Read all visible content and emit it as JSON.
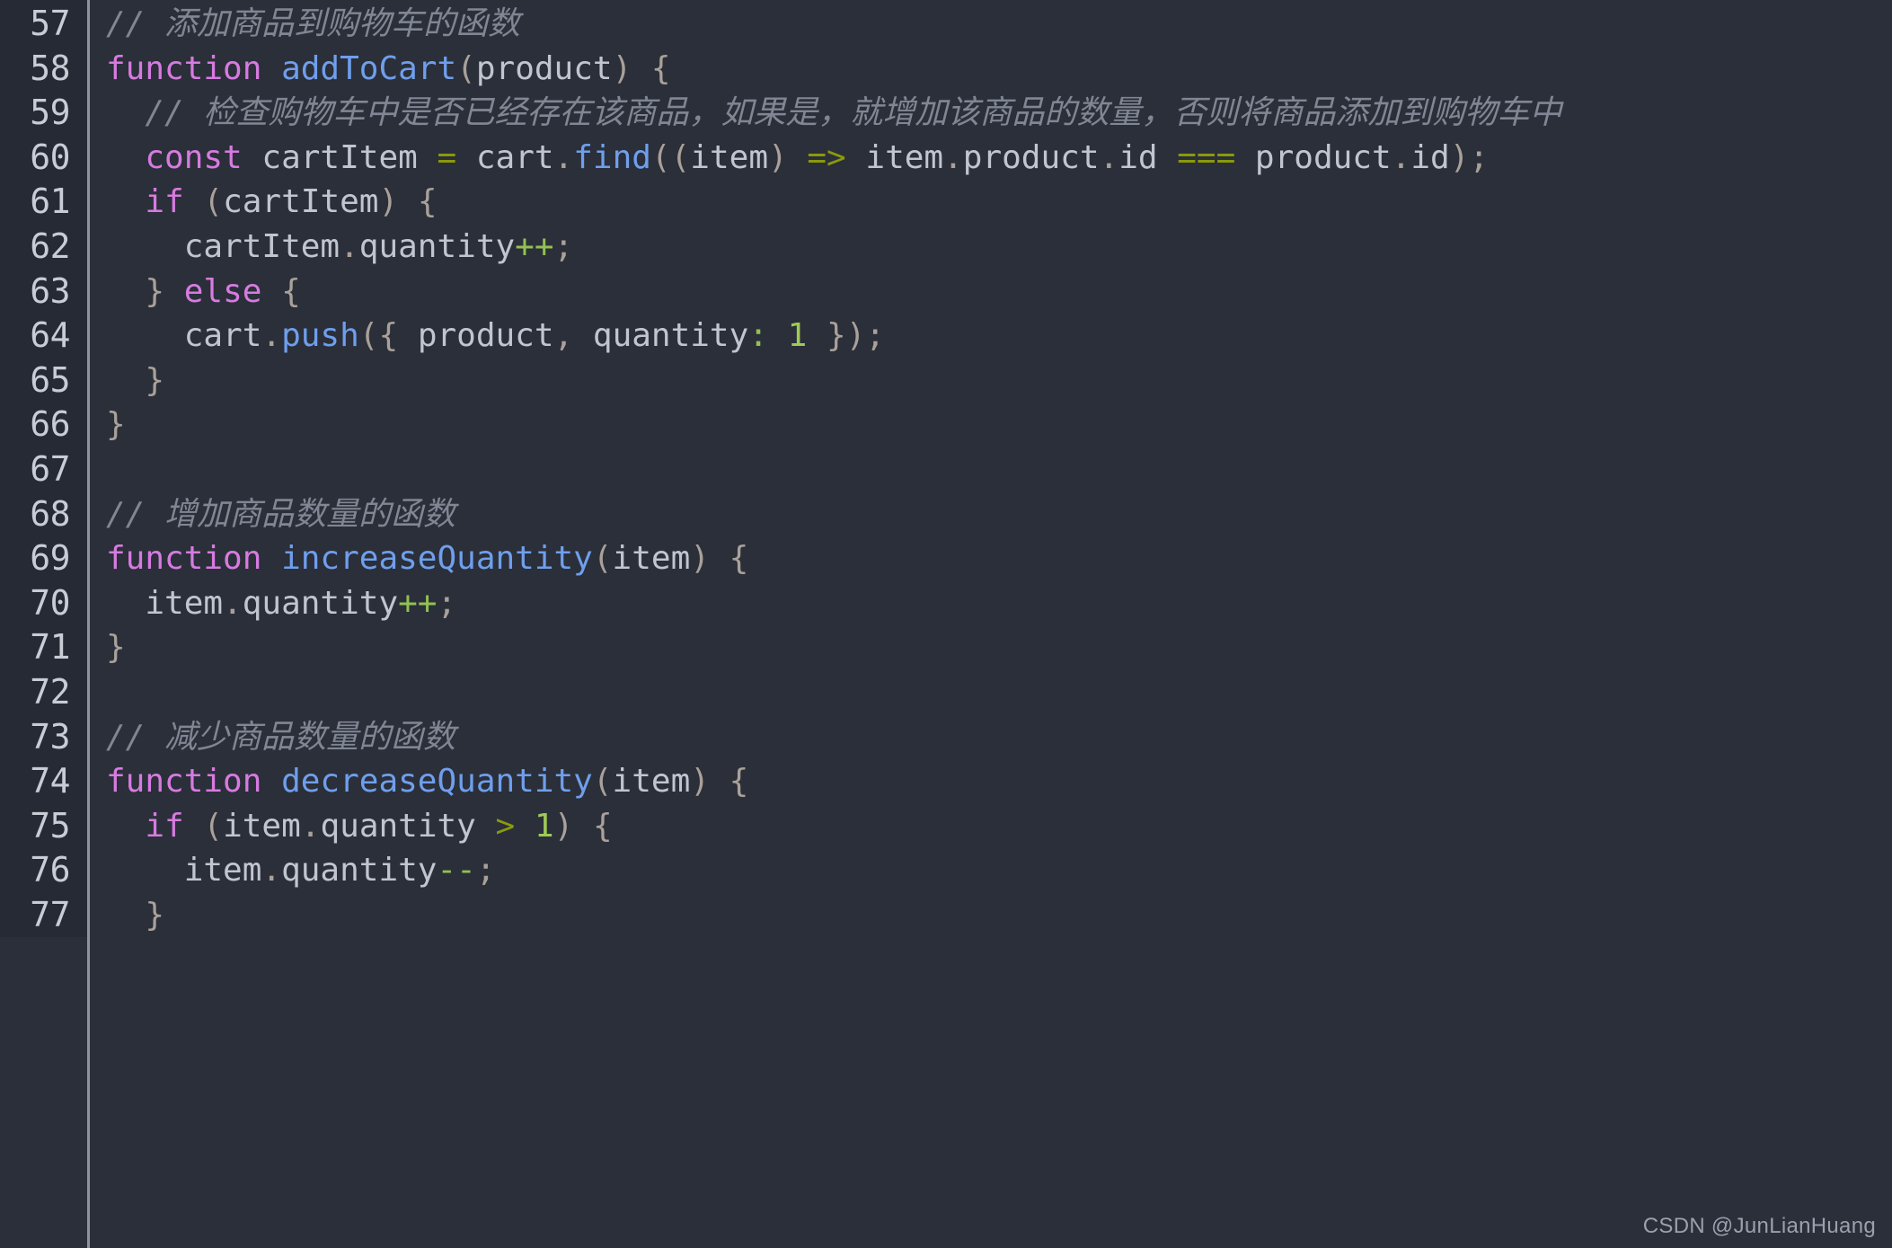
{
  "editor": {
    "language": "javascript",
    "theme": "dark",
    "background_color": "#2b2f3a",
    "gutter_color": "#262a34",
    "first_line": 57,
    "last_line": 77
  },
  "watermark": {
    "text": "CSDN @JunLianHuang"
  },
  "colors": {
    "comment": "#808693",
    "keyword": "#d77be0",
    "function": "#6f9fec",
    "plain": "#c0c5ce",
    "punctuation": "#a9a199",
    "operator": "#8a9a0b",
    "operator_bright": "#93c052",
    "number": "#9fca56",
    "line_number": "#c8ccd4"
  },
  "lines": [
    {
      "number": "57",
      "text": "// 添加商品到购物车的函数"
    },
    {
      "number": "58",
      "text": "function addToCart(product) {"
    },
    {
      "number": "59",
      "text": "  // 检查购物车中是否已经存在该商品，如果是，就增加该商品的数量，否则将商品添加到购物车中"
    },
    {
      "number": "60",
      "text": "  const cartItem = cart.find((item) => item.product.id === product.id);"
    },
    {
      "number": "61",
      "text": "  if (cartItem) {"
    },
    {
      "number": "62",
      "text": "    cartItem.quantity++;"
    },
    {
      "number": "63",
      "text": "  } else {"
    },
    {
      "number": "64",
      "text": "    cart.push({ product, quantity: 1 });"
    },
    {
      "number": "65",
      "text": "  }"
    },
    {
      "number": "66",
      "text": "}"
    },
    {
      "number": "67",
      "text": ""
    },
    {
      "number": "68",
      "text": "// 增加商品数量的函数"
    },
    {
      "number": "69",
      "text": "function increaseQuantity(item) {"
    },
    {
      "number": "70",
      "text": "  item.quantity++;"
    },
    {
      "number": "71",
      "text": "}"
    },
    {
      "number": "72",
      "text": ""
    },
    {
      "number": "73",
      "text": "// 减少商品数量的函数"
    },
    {
      "number": "74",
      "text": "function decreaseQuantity(item) {"
    },
    {
      "number": "75",
      "text": "  if (item.quantity > 1) {"
    },
    {
      "number": "76",
      "text": "    item.quantity--;"
    },
    {
      "number": "77",
      "text": "  }"
    }
  ],
  "tokenized_lines": [
    [
      {
        "t": "// 添加商品到购物车的函数",
        "c": "comment"
      }
    ],
    [
      {
        "t": "function",
        "c": "keyword"
      },
      {
        "t": " ",
        "c": "plain"
      },
      {
        "t": "addToCart",
        "c": "func"
      },
      {
        "t": "(",
        "c": "punct"
      },
      {
        "t": "product",
        "c": "plain"
      },
      {
        "t": ") {",
        "c": "punct"
      }
    ],
    [
      {
        "t": "  ",
        "c": "plain"
      },
      {
        "t": "// 检查购物车中是否已经存在该商品，如果是，就增加该商品的数量，否则将商品添加到购物车中",
        "c": "comment"
      }
    ],
    [
      {
        "t": "  ",
        "c": "plain"
      },
      {
        "t": "const",
        "c": "keyword"
      },
      {
        "t": " cartItem ",
        "c": "plain"
      },
      {
        "t": "=",
        "c": "op"
      },
      {
        "t": " cart",
        "c": "plain"
      },
      {
        "t": ".",
        "c": "punct"
      },
      {
        "t": "find",
        "c": "func"
      },
      {
        "t": "((",
        "c": "punct"
      },
      {
        "t": "item",
        "c": "plain"
      },
      {
        "t": ") ",
        "c": "punct"
      },
      {
        "t": "=>",
        "c": "op"
      },
      {
        "t": " item",
        "c": "plain"
      },
      {
        "t": ".",
        "c": "punct"
      },
      {
        "t": "product",
        "c": "plain"
      },
      {
        "t": ".",
        "c": "punct"
      },
      {
        "t": "id ",
        "c": "plain"
      },
      {
        "t": "===",
        "c": "op"
      },
      {
        "t": " product",
        "c": "plain"
      },
      {
        "t": ".",
        "c": "punct"
      },
      {
        "t": "id",
        "c": "plain"
      },
      {
        "t": ");",
        "c": "punct"
      }
    ],
    [
      {
        "t": "  ",
        "c": "plain"
      },
      {
        "t": "if",
        "c": "keyword"
      },
      {
        "t": " (",
        "c": "punct"
      },
      {
        "t": "cartItem",
        "c": "plain"
      },
      {
        "t": ") {",
        "c": "punct"
      }
    ],
    [
      {
        "t": "    cartItem",
        "c": "plain"
      },
      {
        "t": ".",
        "c": "punct"
      },
      {
        "t": "quantity",
        "c": "plain"
      },
      {
        "t": "++",
        "c": "op2"
      },
      {
        "t": ";",
        "c": "punct"
      }
    ],
    [
      {
        "t": "  ",
        "c": "plain"
      },
      {
        "t": "}",
        "c": "punct"
      },
      {
        "t": " ",
        "c": "plain"
      },
      {
        "t": "else",
        "c": "keyword"
      },
      {
        "t": " {",
        "c": "punct"
      }
    ],
    [
      {
        "t": "    cart",
        "c": "plain"
      },
      {
        "t": ".",
        "c": "punct"
      },
      {
        "t": "push",
        "c": "func"
      },
      {
        "t": "({",
        "c": "punct"
      },
      {
        "t": " product",
        "c": "plain"
      },
      {
        "t": ",",
        "c": "punct"
      },
      {
        "t": " quantity",
        "c": "plain"
      },
      {
        "t": ":",
        "c": "op2"
      },
      {
        "t": " ",
        "c": "plain"
      },
      {
        "t": "1",
        "c": "number"
      },
      {
        "t": " });",
        "c": "punct"
      }
    ],
    [
      {
        "t": "  ",
        "c": "plain"
      },
      {
        "t": "}",
        "c": "punct"
      }
    ],
    [
      {
        "t": "}",
        "c": "punct"
      }
    ],
    [],
    [
      {
        "t": "// 增加商品数量的函数",
        "c": "comment"
      }
    ],
    [
      {
        "t": "function",
        "c": "keyword"
      },
      {
        "t": " ",
        "c": "plain"
      },
      {
        "t": "increaseQuantity",
        "c": "func"
      },
      {
        "t": "(",
        "c": "punct"
      },
      {
        "t": "item",
        "c": "plain"
      },
      {
        "t": ") {",
        "c": "punct"
      }
    ],
    [
      {
        "t": "  item",
        "c": "plain"
      },
      {
        "t": ".",
        "c": "punct"
      },
      {
        "t": "quantity",
        "c": "plain"
      },
      {
        "t": "++",
        "c": "op2"
      },
      {
        "t": ";",
        "c": "punct"
      }
    ],
    [
      {
        "t": "}",
        "c": "punct"
      }
    ],
    [],
    [
      {
        "t": "// 减少商品数量的函数",
        "c": "comment"
      }
    ],
    [
      {
        "t": "function",
        "c": "keyword"
      },
      {
        "t": " ",
        "c": "plain"
      },
      {
        "t": "decreaseQuantity",
        "c": "func"
      },
      {
        "t": "(",
        "c": "punct"
      },
      {
        "t": "item",
        "c": "plain"
      },
      {
        "t": ") {",
        "c": "punct"
      }
    ],
    [
      {
        "t": "  ",
        "c": "plain"
      },
      {
        "t": "if",
        "c": "keyword"
      },
      {
        "t": " (",
        "c": "punct"
      },
      {
        "t": "item",
        "c": "plain"
      },
      {
        "t": ".",
        "c": "punct"
      },
      {
        "t": "quantity ",
        "c": "plain"
      },
      {
        "t": ">",
        "c": "op"
      },
      {
        "t": " ",
        "c": "plain"
      },
      {
        "t": "1",
        "c": "number"
      },
      {
        "t": ") {",
        "c": "punct"
      }
    ],
    [
      {
        "t": "    item",
        "c": "plain"
      },
      {
        "t": ".",
        "c": "punct"
      },
      {
        "t": "quantity",
        "c": "plain"
      },
      {
        "t": "--",
        "c": "op2"
      },
      {
        "t": ";",
        "c": "punct"
      }
    ],
    [
      {
        "t": "  ",
        "c": "plain"
      },
      {
        "t": "}",
        "c": "punct"
      }
    ]
  ]
}
